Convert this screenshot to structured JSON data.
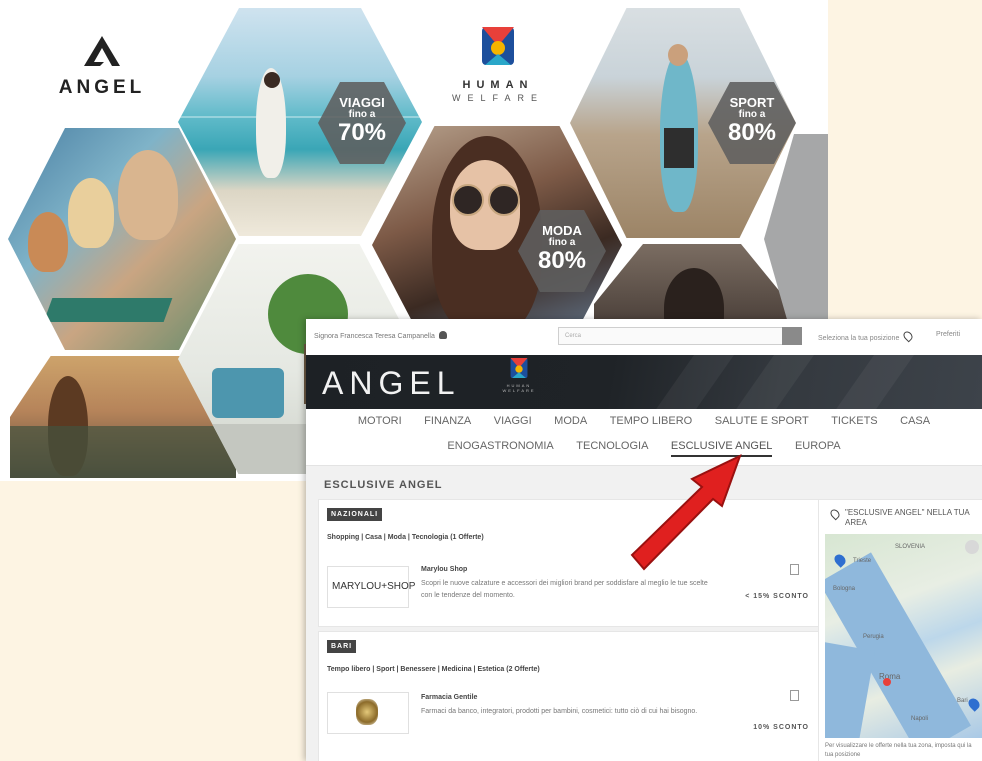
{
  "promo": {
    "brand": "ANGEL",
    "partner_line1": "HUMAN",
    "partner_line2": "WELFARE",
    "badges": [
      {
        "title": "VIAGGI",
        "sub": "fino a",
        "value": "70%"
      },
      {
        "title": "MODA",
        "sub": "fino a",
        "value": "80%"
      },
      {
        "title": "SPORT",
        "sub": "fino a",
        "value": "80%"
      }
    ]
  },
  "site": {
    "topbar": {
      "user": "Signora Francesca Teresa Campanella",
      "search_placeholder": "Cerca",
      "position": "Seleziona la tua posizione",
      "preferences": "Preferiti"
    },
    "hero": {
      "brand": "ANGEL",
      "partner": "HUMAN WELFARE"
    },
    "nav": {
      "row1": [
        "MOTORI",
        "FINANZA",
        "VIAGGI",
        "MODA",
        "TEMPO LIBERO",
        "SALUTE E SPORT",
        "TICKETS",
        "CASA"
      ],
      "row2": [
        "ENOGASTRONOMIA",
        "TECNOLOGIA",
        "ESCLUSIVE ANGEL",
        "EUROPA"
      ],
      "active": "ESCLUSIVE ANGEL"
    },
    "section_title": "ESCLUSIVE ANGEL",
    "cards": [
      {
        "tag": "NAZIONALI",
        "categories": "Shopping | Casa | Moda | Tecnologia (1 Offerte)",
        "logo_text": "MARYLOU+SHOP",
        "offer_name": "Marylou Shop",
        "offer_desc": "Scopri le nuove calzature e accessori dei migliori brand per soddisfare al meglio le tue scelte con le tendenze del momento.",
        "discount": "< 15% SCONTO"
      },
      {
        "tag": "BARI",
        "categories": "Tempo libero | Sport | Benessere | Medicina | Estetica (2 Offerte)",
        "offer_name": "Farmacia Gentile",
        "offer_desc": "Farmaci da banco, integratori, prodotti per bambini, cosmetici: tutto ciò di cui hai bisogno.",
        "discount": "10% SCONTO"
      }
    ],
    "side": {
      "title": "\"ESCLUSIVE ANGEL\" NELLA TUA AREA",
      "map_labels": [
        "SLOVENIA",
        "Trieste",
        "Bologna",
        "Perugia",
        "Roma",
        "Napoli",
        "Bari"
      ],
      "note": "Per visualizzare le offerte nella tua zona, imposta qui la tua posizione"
    }
  },
  "colors": {
    "background": "#fdf4e3",
    "badge": "#5f5f5f",
    "hero_dark": "#1f2327",
    "arrow": "#e0201f"
  }
}
